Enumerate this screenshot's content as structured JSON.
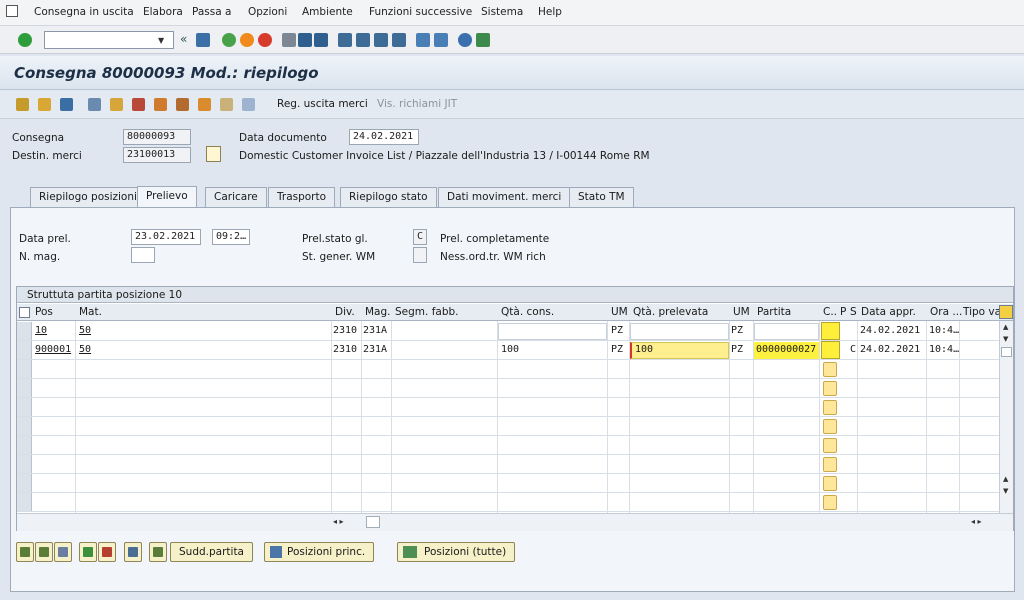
{
  "menu": [
    {
      "label": "Consegna in uscita"
    },
    {
      "label": "Elabora"
    },
    {
      "label": "Passa a"
    },
    {
      "label": "Opzioni"
    },
    {
      "label": "Ambiente"
    },
    {
      "label": "Funzioni successive"
    },
    {
      "label": "Sistema"
    },
    {
      "label": "Help"
    }
  ],
  "toolbar": {
    "command_value": ""
  },
  "title": "Consegna 80000093 Mod.: riepilogo",
  "app_toolbar": {
    "goods_issue": "Reg. uscita merci",
    "jit_calls": "Vis. richiami JIT"
  },
  "header": {
    "delivery_label": "Consegna",
    "delivery_value": "80000093",
    "doc_date_label": "Data documento",
    "doc_date_value": "24.02.2021",
    "ship_to_label": "Destin. merci",
    "ship_to_value": "23100013",
    "ship_to_text": "Domestic Customer Invoice List / Piazzale dell'Industria 13 / I-00144 Rome RM"
  },
  "tabs": [
    {
      "label": "Riepilogo posizioni"
    },
    {
      "label": "Prelievo"
    },
    {
      "label": "Caricare"
    },
    {
      "label": "Trasporto"
    },
    {
      "label": "Riepilogo stato"
    },
    {
      "label": "Dati moviment. merci"
    },
    {
      "label": "Stato TM"
    }
  ],
  "picking": {
    "date_label": "Data prel.",
    "date_value": "23.02.2021",
    "time_value": "09:2…",
    "wh_label": "N. mag.",
    "overall_status_label": "Prel.stato gl.",
    "overall_status_value": "C",
    "overall_status_text": "Prel. completamente",
    "wm_status_label": "St. gener. WM",
    "wm_status_text": "Ness.ord.tr. WM rich"
  },
  "table": {
    "caption": "Struttuta partita posizione 10",
    "columns": [
      "Pos",
      "Mat.",
      "Div.",
      "Mag.",
      "Segm. fabb.",
      "Qtà. cons.",
      "UM",
      "Qtà. prelevata",
      "UM",
      "Partita",
      "C..",
      "P",
      "S",
      "Data appr.",
      "Ora ...",
      "Tipo va"
    ],
    "rows": [
      {
        "pos": "10",
        "mat": "50",
        "div": "2310",
        "mag": "231A",
        "segm": "",
        "qty_del": "",
        "um1": "PZ",
        "qty_pick": "",
        "um2": "PZ",
        "batch": "",
        "p": "",
        "s": "",
        "date": "24.02.2021",
        "time": "10:4…"
      },
      {
        "pos": "900001",
        "mat": "50",
        "div": "2310",
        "mag": "231A",
        "segm": "",
        "qty_del": "100",
        "um1": "PZ",
        "qty_pick": "100",
        "um2": "PZ",
        "batch": "0000000027",
        "p": "",
        "s": "C",
        "date": "24.02.2021",
        "time": "10:4…"
      }
    ]
  },
  "bottom_buttons": {
    "split_batch": "Sudd.partita",
    "main_items": "Posizioni princ.",
    "all_items": "Posizioni (tutte)"
  }
}
